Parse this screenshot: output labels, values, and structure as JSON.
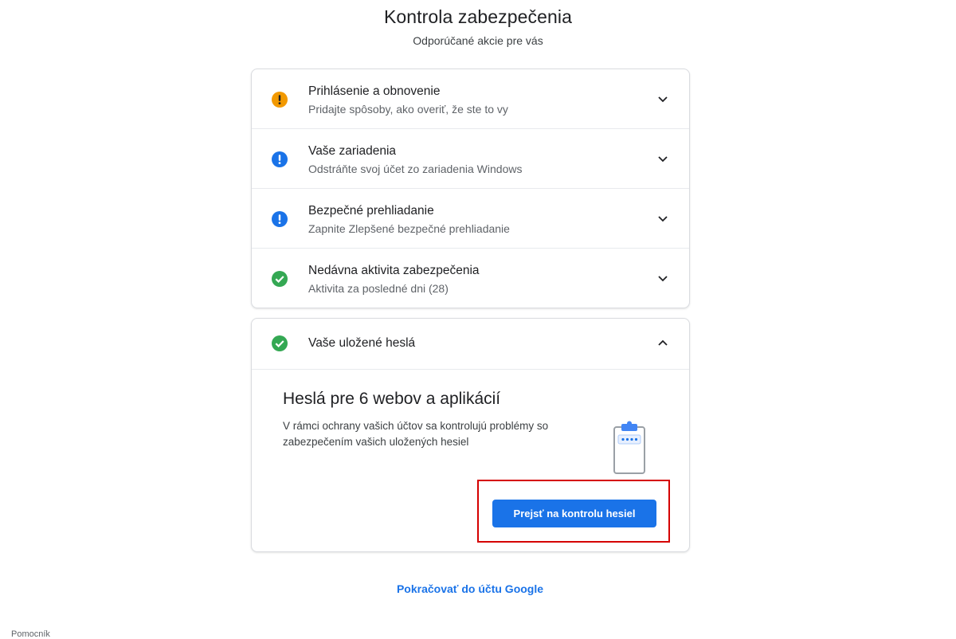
{
  "page": {
    "title": "Kontrola zabezpečenia",
    "subtitle": "Odporúčané akcie pre vás"
  },
  "colors": {
    "warning": "#F29900",
    "info": "#1A73E8",
    "success": "#34A853",
    "highlight_border": "#D50000",
    "button_bg": "#1A73E8"
  },
  "items": [
    {
      "title": "Prihlásenie a obnovenie",
      "subtitle": "Pridajte spôsoby, ako overiť, že ste to vy",
      "status": "warning",
      "icon": "exclamation-icon"
    },
    {
      "title": "Vaše zariadenia",
      "subtitle": "Odstráňte svoj účet zo zariadenia Windows",
      "status": "info",
      "icon": "exclamation-icon"
    },
    {
      "title": "Bezpečné prehliadanie",
      "subtitle": "Zapnite Zlepšené bezpečné prehliadanie",
      "status": "info",
      "icon": "exclamation-icon"
    },
    {
      "title": "Nedávna aktivita zabezpečenia",
      "subtitle": "Aktivita za posledné dni (28)",
      "status": "success",
      "icon": "check-icon"
    }
  ],
  "passwords": {
    "header": "Vaše uložené heslá",
    "status": "success",
    "expanded": true,
    "title": "Heslá pre 6 webov a aplikácií",
    "description": "V rámci ochrany vašich účtov sa kontrolujú problémy so zabezpečením vašich uložených hesiel",
    "illustration": "password-clipboard-icon",
    "button_label": "Prejsť na kontrolu hesiel"
  },
  "continue_link": "Pokračovať do účtu Google",
  "footer": "Pomocník"
}
